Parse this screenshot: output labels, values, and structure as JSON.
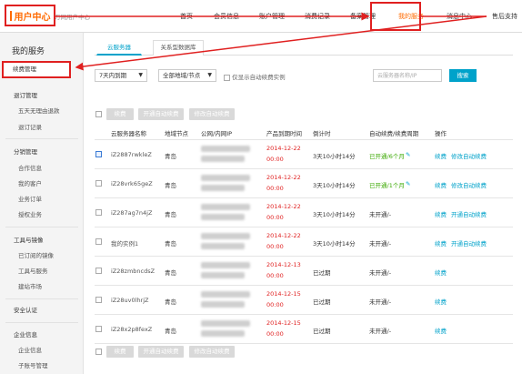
{
  "header": {
    "logo_text": "用户中心",
    "logo_sub": "万网用户中心",
    "nav": [
      {
        "label": "首页",
        "active": false
      },
      {
        "label": "会员信息",
        "active": false
      },
      {
        "label": "账户管理",
        "active": false
      },
      {
        "label": "消费记录",
        "active": false
      },
      {
        "label": "备案管理",
        "active": false
      },
      {
        "label": "我的服务",
        "active": true
      },
      {
        "label": "消息中心",
        "active": false
      },
      {
        "label": "售后支持",
        "active": false
      }
    ]
  },
  "sidebar": {
    "title": "我的服务",
    "current": "续费管理",
    "groups": [
      {
        "label": "退订管理",
        "items": [
          "五天无理由退款",
          "退订记录"
        ]
      },
      {
        "label": "分销管理",
        "items": [
          "合作信息",
          "我的客户",
          "业务订单",
          "授权业务"
        ]
      },
      {
        "label": "工具与镜像",
        "items": [
          "已订阅的镜像",
          "工具与服务",
          "建站市场"
        ]
      },
      {
        "label": "安全认证",
        "items": []
      },
      {
        "label": "企业信息",
        "items": [
          "企业信息",
          "子账号管理"
        ]
      }
    ]
  },
  "tabs": [
    {
      "label": "云服务器",
      "active": true
    },
    {
      "label": "关系型数据库",
      "active": false
    }
  ],
  "filters": {
    "period": "7天内到期",
    "region": "全部地域/节点",
    "auto_renew_only_label": "仅显示自动续费实例",
    "search_placeholder": "云服务器名称/IP",
    "search_button": "搜索"
  },
  "toolbar": {
    "renew": "续费",
    "enable_auto": "开通自动续费",
    "modify_auto": "修改自动续费"
  },
  "table": {
    "columns": [
      "云服务器名称",
      "地域节点",
      "公网/内网IP",
      "产品到期时间",
      "倒计时",
      "自动续费/续费周期",
      "操作"
    ],
    "rows": [
      {
        "name": "iZ2887rwkleZ",
        "region": "青岛",
        "expire_date": "2014-12-22",
        "expire_time": "00:00",
        "countdown": "3天10小时14分",
        "auto_renew": "已开通/6个月",
        "auto_on": true,
        "actions": [
          "续费",
          "修改自动续费"
        ]
      },
      {
        "name": "iZ28vrk65geZ",
        "region": "青岛",
        "expire_date": "2014-12-22",
        "expire_time": "00:00",
        "countdown": "3天10小时14分",
        "auto_renew": "已开通/1个月",
        "auto_on": true,
        "actions": [
          "续费",
          "修改自动续费"
        ]
      },
      {
        "name": "iZ287ag7n4jZ",
        "region": "青岛",
        "expire_date": "2014-12-22",
        "expire_time": "00:00",
        "countdown": "3天10小时14分",
        "auto_renew": "未开通/-",
        "auto_on": false,
        "actions": [
          "续费",
          "开通自动续费"
        ]
      },
      {
        "name": "我的实例1",
        "region": "青岛",
        "expire_date": "2014-12-22",
        "expire_time": "00:00",
        "countdown": "3天10小时14分",
        "auto_renew": "未开通/-",
        "auto_on": false,
        "actions": [
          "续费",
          "开通自动续费"
        ]
      },
      {
        "name": "iZ28zmbncdsZ",
        "region": "青岛",
        "expire_date": "2014-12-13",
        "expire_time": "00:00",
        "countdown": "已过期",
        "auto_renew": "未开通/-",
        "auto_on": false,
        "actions": [
          "续费"
        ]
      },
      {
        "name": "iZ28uv0lhrjZ",
        "region": "青岛",
        "expire_date": "2014-12-15",
        "expire_time": "00:00",
        "countdown": "已过期",
        "auto_renew": "未开通/-",
        "auto_on": false,
        "actions": [
          "续费"
        ]
      },
      {
        "name": "iZ28x2p8fexZ",
        "region": "青岛",
        "expire_date": "2014-12-15",
        "expire_time": "00:00",
        "countdown": "已过期",
        "auto_renew": "未开通/-",
        "auto_on": false,
        "actions": [
          "续费"
        ]
      }
    ]
  },
  "colors": {
    "accent": "#00a2ca",
    "highlight": "#e02020",
    "active_nav": "#ff6a00",
    "success": "#3aa800"
  }
}
